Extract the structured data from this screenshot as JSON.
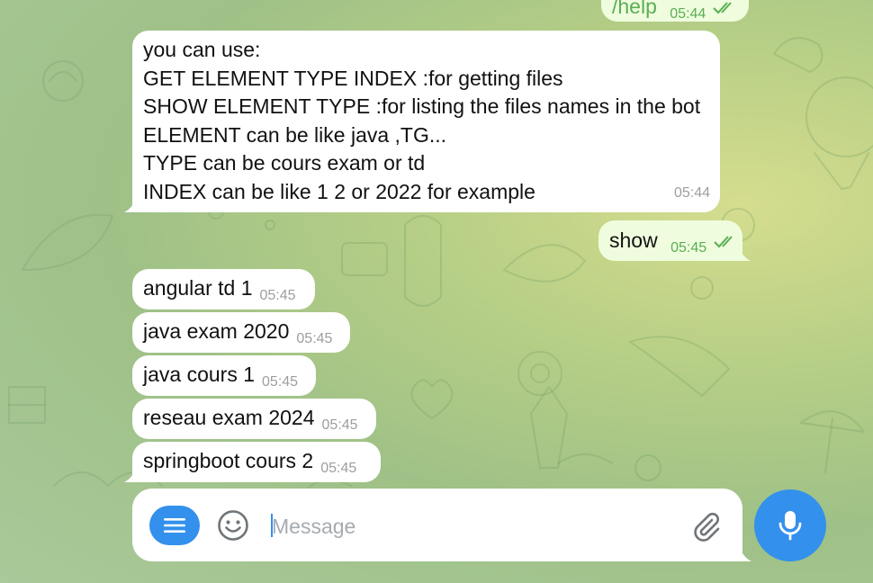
{
  "colors": {
    "accent": "#3390ec",
    "outgoing_bubble": "#effdde",
    "incoming_bubble": "#ffffff",
    "read_tick": "#5bad54"
  },
  "messages": {
    "help_cmd": {
      "text": "/help",
      "time": "05:44",
      "status": "read",
      "icon": "double-check-icon"
    },
    "bot_help": {
      "lines": [
        "you can use:",
        "GET ELEMENT TYPE INDEX :for getting files",
        "SHOW ELEMENT TYPE :for listing the files names in the bot",
        "ELEMENT can be like java ,TG...",
        "TYPE can be cours exam or td",
        "INDEX can be like 1 2 or 2022 for example"
      ],
      "time": "05:44"
    },
    "show_cmd": {
      "text": "show",
      "time": "05:45",
      "status": "read",
      "icon": "double-check-icon"
    },
    "results": [
      {
        "text": "angular td 1",
        "time": "05:45"
      },
      {
        "text": "java exam 2020",
        "time": "05:45"
      },
      {
        "text": "java cours 1",
        "time": "05:45"
      },
      {
        "text": "reseau exam 2024",
        "time": "05:45"
      },
      {
        "text": "springboot cours 2",
        "time": "05:45"
      }
    ]
  },
  "composer": {
    "placeholder": "Message",
    "value": "",
    "icons": {
      "menu": "menu-icon",
      "emoji": "smiley-icon",
      "attach": "paperclip-icon",
      "mic": "microphone-icon"
    }
  }
}
